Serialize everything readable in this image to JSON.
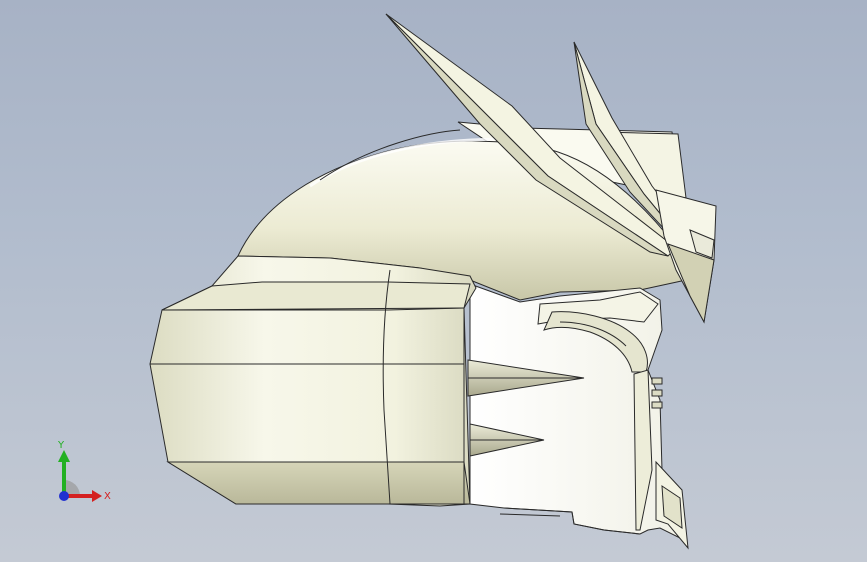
{
  "viewport": {
    "background_top": "#a7b2c5",
    "background_bottom": "#c4cad4"
  },
  "model": {
    "shell_color": "#f0f0dc",
    "shadow_color": "#c9c9ad",
    "edge_color": "#2a2a2a"
  },
  "triad": {
    "x_label": "X",
    "y_label": "Y",
    "x_color": "#d42020",
    "y_color": "#22b022",
    "z_color": "#2030d0"
  }
}
